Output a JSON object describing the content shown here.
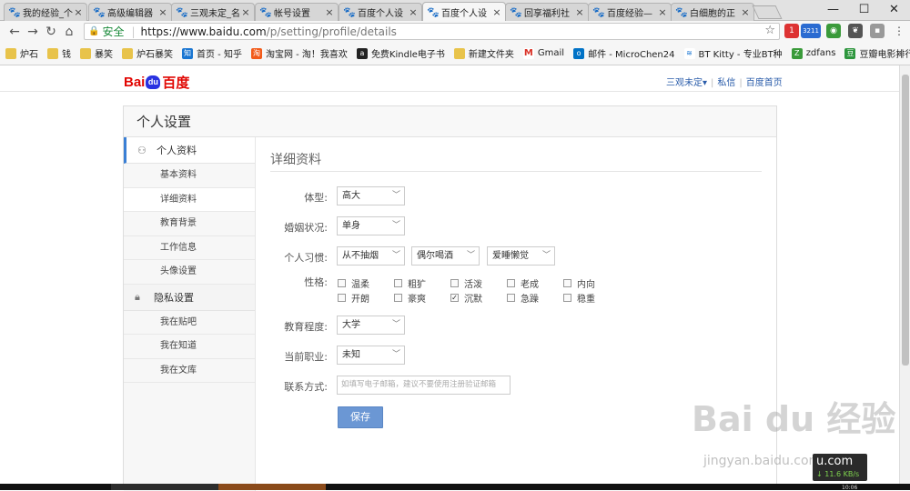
{
  "browser": {
    "tabs": [
      {
        "label": "我的经验_个"
      },
      {
        "label": "高级编辑器"
      },
      {
        "label": "三观未定_名"
      },
      {
        "label": "帐号设置"
      },
      {
        "label": "百度个人设"
      },
      {
        "label": "回享福利社"
      },
      {
        "label": "百度经验—"
      },
      {
        "label": "白细胞的正"
      }
    ],
    "active_tab_index": 4,
    "secure_label": "安全",
    "url_host": "https://www.baidu.com",
    "url_path": "/p/setting/profile/details",
    "ext_badge": "3211",
    "ext_count": "1",
    "bookmarks": [
      {
        "label": "炉石"
      },
      {
        "label": "钱"
      },
      {
        "label": "暴笑"
      },
      {
        "label": "炉石暴笑"
      },
      {
        "label": "首页 - 知乎"
      },
      {
        "label": "淘宝网 - 淘！我喜欢"
      },
      {
        "label": "免费Kindle电子书"
      },
      {
        "label": "新建文件夹"
      },
      {
        "label": "Gmail"
      },
      {
        "label": "邮件 - MicroChen24"
      },
      {
        "label": "BT Kitty - 专业BT种"
      },
      {
        "label": "zdfans"
      },
      {
        "label": "豆瓣电影排行榜"
      }
    ],
    "window_min": "—",
    "window_max": "☐",
    "window_close": "✕"
  },
  "header": {
    "logo_bai": "Bai",
    "logo_du": "du",
    "logo_cn": "百度",
    "username": "三观未定▾",
    "link_message": "私信",
    "link_home": "百度首页"
  },
  "settings": {
    "title": "个人设置",
    "groups": [
      {
        "label": "个人资料",
        "icon": "person-icon",
        "items": [
          "基本资料",
          "详细资料",
          "教育背景",
          "工作信息",
          "头像设置"
        ]
      },
      {
        "label": "隐私设置",
        "icon": "lock-icon",
        "items": [
          "我在贴吧",
          "我在知道",
          "我在文库"
        ]
      }
    ],
    "current_item": "详细资料",
    "section_title": "详细资料",
    "form": {
      "body_label": "体型:",
      "body_value": "高大",
      "marriage_label": "婚姻状况:",
      "marriage_value": "单身",
      "habit_label": "个人习惯:",
      "habit_values": [
        "从不抽烟",
        "偶尔喝酒",
        "爱睡懒觉"
      ],
      "personality_label": "性格:",
      "personality_options": [
        {
          "label": "温柔",
          "checked": false
        },
        {
          "label": "粗犷",
          "checked": false
        },
        {
          "label": "活泼",
          "checked": false
        },
        {
          "label": "老成",
          "checked": false
        },
        {
          "label": "内向",
          "checked": false
        },
        {
          "label": "开朗",
          "checked": false
        },
        {
          "label": "豪爽",
          "checked": false
        },
        {
          "label": "沉默",
          "checked": true
        },
        {
          "label": "急躁",
          "checked": false
        },
        {
          "label": "稳重",
          "checked": false
        }
      ],
      "education_label": "教育程度:",
      "education_value": "大学",
      "job_label": "当前职业:",
      "job_value": "未知",
      "contact_label": "联系方式:",
      "contact_placeholder": "如填写电子邮箱，建议不要使用注册验证邮箱",
      "save_label": "保存"
    }
  },
  "overlay": {
    "watermark": "Bai du 经验",
    "watermark_url": "jingyan.baidu.com",
    "net_host": "u.com",
    "net_speed": "↓ 11.6 KB/s",
    "clock": "10:06"
  }
}
